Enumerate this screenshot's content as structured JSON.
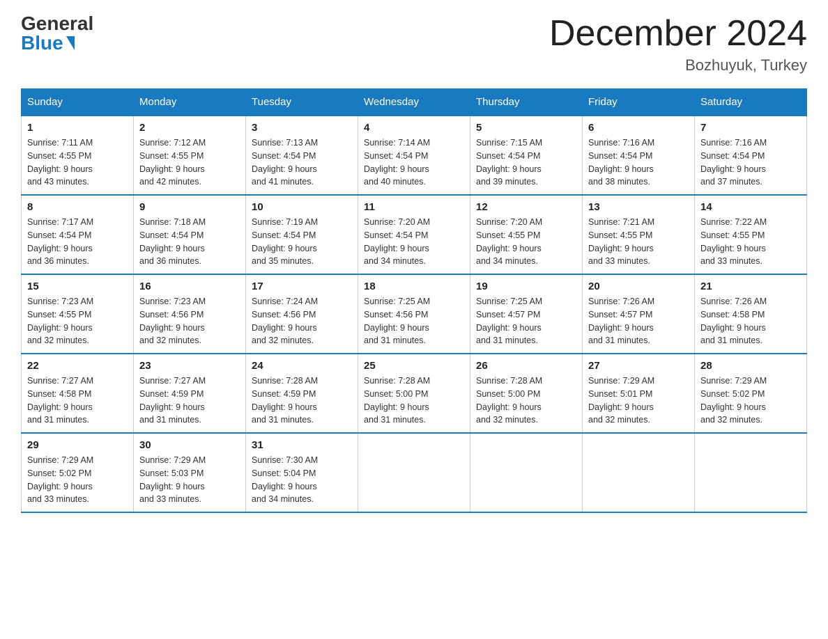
{
  "header": {
    "logo_general": "General",
    "logo_blue": "Blue",
    "month_title": "December 2024",
    "location": "Bozhuyuk, Turkey"
  },
  "calendar": {
    "days_of_week": [
      "Sunday",
      "Monday",
      "Tuesday",
      "Wednesday",
      "Thursday",
      "Friday",
      "Saturday"
    ],
    "weeks": [
      [
        {
          "day": "1",
          "sunrise": "7:11 AM",
          "sunset": "4:55 PM",
          "daylight": "9 hours and 43 minutes."
        },
        {
          "day": "2",
          "sunrise": "7:12 AM",
          "sunset": "4:55 PM",
          "daylight": "9 hours and 42 minutes."
        },
        {
          "day": "3",
          "sunrise": "7:13 AM",
          "sunset": "4:54 PM",
          "daylight": "9 hours and 41 minutes."
        },
        {
          "day": "4",
          "sunrise": "7:14 AM",
          "sunset": "4:54 PM",
          "daylight": "9 hours and 40 minutes."
        },
        {
          "day": "5",
          "sunrise": "7:15 AM",
          "sunset": "4:54 PM",
          "daylight": "9 hours and 39 minutes."
        },
        {
          "day": "6",
          "sunrise": "7:16 AM",
          "sunset": "4:54 PM",
          "daylight": "9 hours and 38 minutes."
        },
        {
          "day": "7",
          "sunrise": "7:16 AM",
          "sunset": "4:54 PM",
          "daylight": "9 hours and 37 minutes."
        }
      ],
      [
        {
          "day": "8",
          "sunrise": "7:17 AM",
          "sunset": "4:54 PM",
          "daylight": "9 hours and 36 minutes."
        },
        {
          "day": "9",
          "sunrise": "7:18 AM",
          "sunset": "4:54 PM",
          "daylight": "9 hours and 36 minutes."
        },
        {
          "day": "10",
          "sunrise": "7:19 AM",
          "sunset": "4:54 PM",
          "daylight": "9 hours and 35 minutes."
        },
        {
          "day": "11",
          "sunrise": "7:20 AM",
          "sunset": "4:54 PM",
          "daylight": "9 hours and 34 minutes."
        },
        {
          "day": "12",
          "sunrise": "7:20 AM",
          "sunset": "4:55 PM",
          "daylight": "9 hours and 34 minutes."
        },
        {
          "day": "13",
          "sunrise": "7:21 AM",
          "sunset": "4:55 PM",
          "daylight": "9 hours and 33 minutes."
        },
        {
          "day": "14",
          "sunrise": "7:22 AM",
          "sunset": "4:55 PM",
          "daylight": "9 hours and 33 minutes."
        }
      ],
      [
        {
          "day": "15",
          "sunrise": "7:23 AM",
          "sunset": "4:55 PM",
          "daylight": "9 hours and 32 minutes."
        },
        {
          "day": "16",
          "sunrise": "7:23 AM",
          "sunset": "4:56 PM",
          "daylight": "9 hours and 32 minutes."
        },
        {
          "day": "17",
          "sunrise": "7:24 AM",
          "sunset": "4:56 PM",
          "daylight": "9 hours and 32 minutes."
        },
        {
          "day": "18",
          "sunrise": "7:25 AM",
          "sunset": "4:56 PM",
          "daylight": "9 hours and 31 minutes."
        },
        {
          "day": "19",
          "sunrise": "7:25 AM",
          "sunset": "4:57 PM",
          "daylight": "9 hours and 31 minutes."
        },
        {
          "day": "20",
          "sunrise": "7:26 AM",
          "sunset": "4:57 PM",
          "daylight": "9 hours and 31 minutes."
        },
        {
          "day": "21",
          "sunrise": "7:26 AM",
          "sunset": "4:58 PM",
          "daylight": "9 hours and 31 minutes."
        }
      ],
      [
        {
          "day": "22",
          "sunrise": "7:27 AM",
          "sunset": "4:58 PM",
          "daylight": "9 hours and 31 minutes."
        },
        {
          "day": "23",
          "sunrise": "7:27 AM",
          "sunset": "4:59 PM",
          "daylight": "9 hours and 31 minutes."
        },
        {
          "day": "24",
          "sunrise": "7:28 AM",
          "sunset": "4:59 PM",
          "daylight": "9 hours and 31 minutes."
        },
        {
          "day": "25",
          "sunrise": "7:28 AM",
          "sunset": "5:00 PM",
          "daylight": "9 hours and 31 minutes."
        },
        {
          "day": "26",
          "sunrise": "7:28 AM",
          "sunset": "5:00 PM",
          "daylight": "9 hours and 32 minutes."
        },
        {
          "day": "27",
          "sunrise": "7:29 AM",
          "sunset": "5:01 PM",
          "daylight": "9 hours and 32 minutes."
        },
        {
          "day": "28",
          "sunrise": "7:29 AM",
          "sunset": "5:02 PM",
          "daylight": "9 hours and 32 minutes."
        }
      ],
      [
        {
          "day": "29",
          "sunrise": "7:29 AM",
          "sunset": "5:02 PM",
          "daylight": "9 hours and 33 minutes."
        },
        {
          "day": "30",
          "sunrise": "7:29 AM",
          "sunset": "5:03 PM",
          "daylight": "9 hours and 33 minutes."
        },
        {
          "day": "31",
          "sunrise": "7:30 AM",
          "sunset": "5:04 PM",
          "daylight": "9 hours and 34 minutes."
        },
        null,
        null,
        null,
        null
      ]
    ],
    "labels": {
      "sunrise": "Sunrise:",
      "sunset": "Sunset:",
      "daylight": "Daylight:"
    }
  }
}
